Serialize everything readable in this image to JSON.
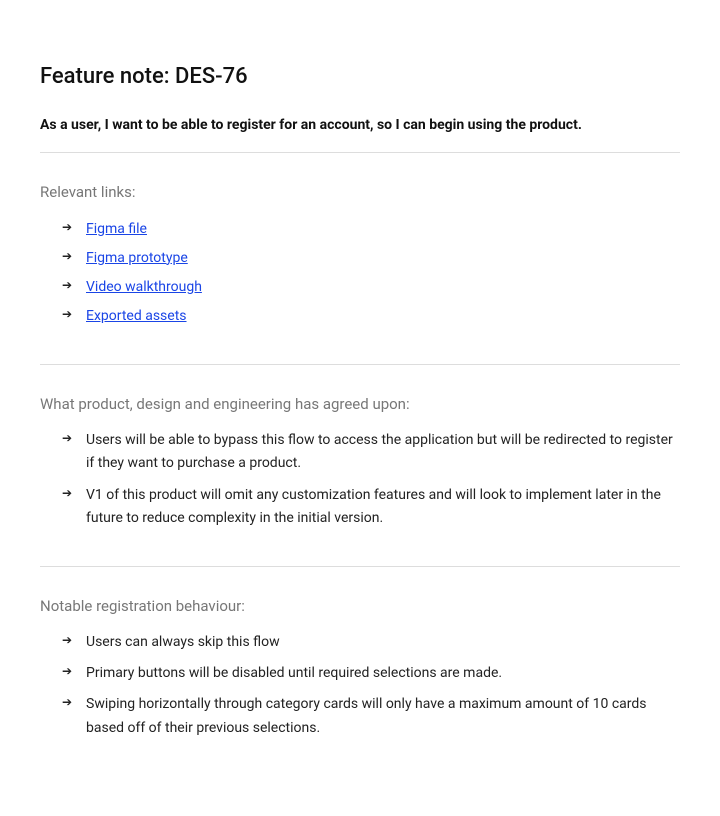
{
  "title": "Feature note: DES-76",
  "userStory": "As a user, I want to be able to register for an account, so I can begin using the product.",
  "linksSection": {
    "heading": "Relevant links:",
    "items": [
      "Figma file",
      "Figma prototype",
      "Video walkthrough",
      "Exported assets"
    ]
  },
  "agreementSection": {
    "heading": "What product, design and engineering has agreed upon:",
    "items": [
      "Users will be able to bypass this flow to access the application but will be redirected to register if they want to purchase a product.",
      "V1 of this product will omit any customization features and will look to implement later in the future to reduce complexity in the initial version."
    ]
  },
  "behaviourSection": {
    "heading": "Notable registration behaviour:",
    "items": [
      "Users can always skip this flow",
      "Primary buttons will be disabled until required selections are made.",
      "Swiping horizontally through category cards will only have a maximum amount of 10 cards based off of their previous selections."
    ]
  }
}
